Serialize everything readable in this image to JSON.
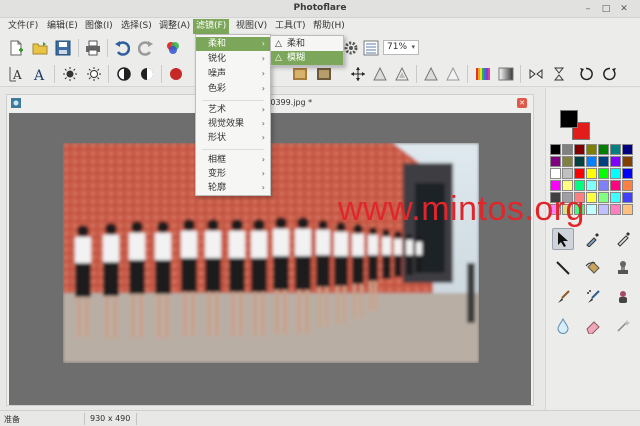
{
  "window": {
    "title": "Photoflare",
    "controls": [
      "–",
      "□",
      "✕"
    ]
  },
  "menubar": {
    "items": [
      {
        "label": "文件(F)"
      },
      {
        "label": "编辑(E)"
      },
      {
        "label": "图像(I)"
      },
      {
        "label": "选择(S)"
      },
      {
        "label": "调整(A)"
      },
      {
        "label": "滤镜(F)",
        "active": true
      },
      {
        "label": "视图(V)"
      },
      {
        "label": "工具(T)"
      },
      {
        "label": "帮助(H)"
      }
    ]
  },
  "toolbar": {
    "zoom_value": "71%",
    "zoom_arrow": "▾"
  },
  "filters_menu": {
    "items": [
      {
        "label": "柔和",
        "has_sub": true,
        "highlight": true
      },
      {
        "label": "锐化",
        "has_sub": true
      },
      {
        "label": "噪声",
        "has_sub": true
      },
      {
        "label": "色彩",
        "has_sub": true
      },
      {
        "label": "艺术",
        "has_sub": true
      },
      {
        "label": "视觉效果",
        "has_sub": true
      },
      {
        "label": "形状",
        "has_sub": true
      },
      {
        "label": "相框",
        "has_sub": true
      },
      {
        "label": "变形",
        "has_sub": true
      },
      {
        "label": "轮廓",
        "has_sub": true
      }
    ],
    "chevron": "›"
  },
  "soften_submenu": {
    "items": [
      {
        "label": "柔和",
        "icon": "triangle-icon"
      },
      {
        "label": "模糊",
        "icon": "triangle-icon",
        "highlight": true
      }
    ]
  },
  "document": {
    "title": "img364110399.jpg *",
    "close": "✕"
  },
  "colors": {
    "accent": "#7ca75a",
    "foreground": "#000000",
    "background": "#e21b1b",
    "palette": [
      "#000000",
      "#808080",
      "#800000",
      "#808000",
      "#008000",
      "#008080",
      "#000080",
      "#800080",
      "#808040",
      "#004040",
      "#0080ff",
      "#004080",
      "#8000ff",
      "#804000",
      "#ffffff",
      "#c0c0c0",
      "#ff0000",
      "#ffff00",
      "#00ff00",
      "#00ffff",
      "#0000ff",
      "#ff00ff",
      "#ffff80",
      "#00ff80",
      "#80ffff",
      "#8080ff",
      "#ff0080",
      "#ff8040",
      "#404040",
      "#a0a0a4",
      "#ff8080",
      "#ffff40",
      "#80ff80",
      "#40ffff",
      "#4040ff",
      "#ff80ff",
      "#e0e080",
      "#40ff80",
      "#c0ffff",
      "#c0c0ff",
      "#ff80c0",
      "#ffc080"
    ]
  },
  "statusbar": {
    "status": "准备",
    "dimensions": "930 x 490"
  },
  "watermark": {
    "text": "www.mintos.org"
  }
}
